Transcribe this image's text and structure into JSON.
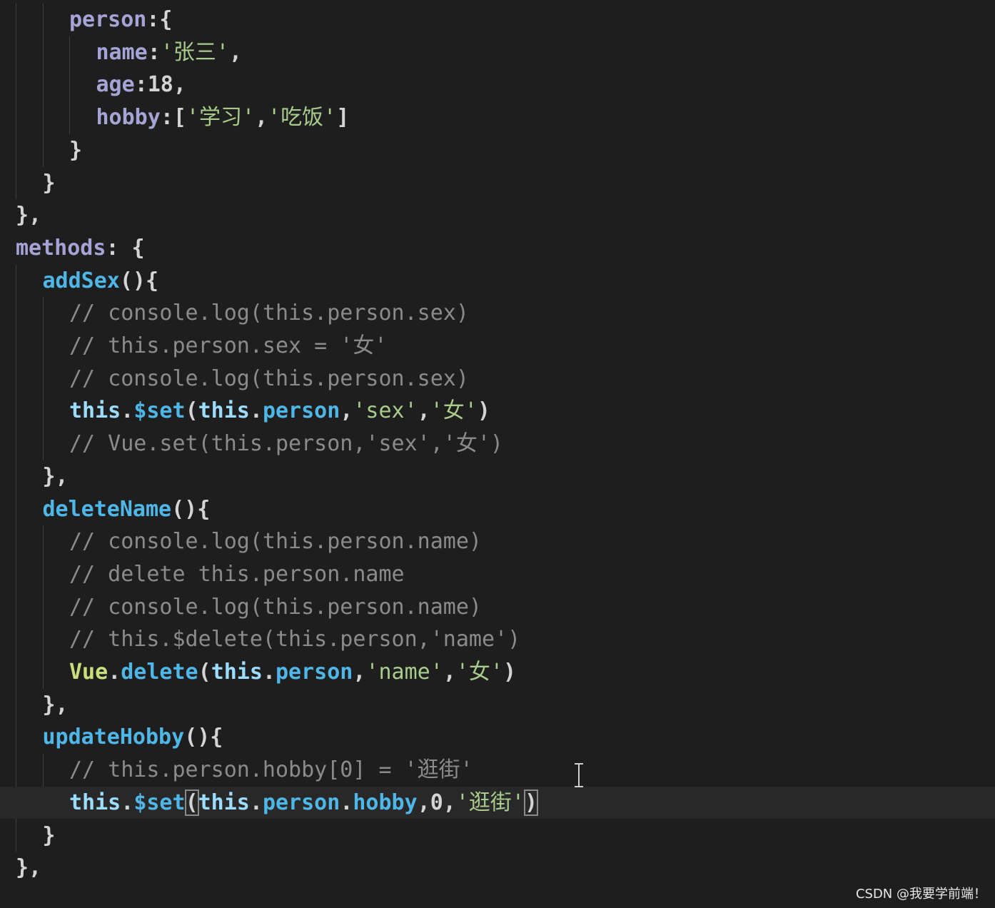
{
  "colors": {
    "background": "#1e1e1e",
    "current_line": "#282828",
    "property": "#a6a3d6",
    "string": "#a8cc8c",
    "number": "#d4d4d4",
    "punct": "#d4d4d4",
    "comment": "#8b8b8b",
    "this": "#9cdcfe",
    "function": "#4fb6e8",
    "member": "#4fb6e8",
    "vue": "#c8e07a"
  },
  "editor": {
    "current_line_index": 24,
    "lines": [
      {
        "indent": 2,
        "tokens": [
          {
            "t": "person",
            "k": "property"
          },
          {
            "t": ":{",
            "k": "punct"
          }
        ]
      },
      {
        "indent": 3,
        "tokens": [
          {
            "t": "name",
            "k": "property"
          },
          {
            "t": ":",
            "k": "punct"
          },
          {
            "t": "'张三'",
            "k": "string"
          },
          {
            "t": ",",
            "k": "punct"
          }
        ]
      },
      {
        "indent": 3,
        "tokens": [
          {
            "t": "age",
            "k": "property"
          },
          {
            "t": ":18,",
            "k": "punct"
          }
        ]
      },
      {
        "indent": 3,
        "tokens": [
          {
            "t": "hobby",
            "k": "property"
          },
          {
            "t": ":[",
            "k": "punct"
          },
          {
            "t": "'学习'",
            "k": "string"
          },
          {
            "t": ",",
            "k": "punct"
          },
          {
            "t": "'吃饭'",
            "k": "string"
          },
          {
            "t": "]",
            "k": "punct"
          }
        ]
      },
      {
        "indent": 2,
        "tokens": [
          {
            "t": "}",
            "k": "punct"
          }
        ]
      },
      {
        "indent": 1,
        "tokens": [
          {
            "t": "}",
            "k": "punct"
          }
        ]
      },
      {
        "indent": 0,
        "tokens": [
          {
            "t": "},",
            "k": "punct"
          }
        ]
      },
      {
        "indent": 0,
        "tokens": [
          {
            "t": "methods",
            "k": "property"
          },
          {
            "t": ": {",
            "k": "punct"
          }
        ]
      },
      {
        "indent": 1,
        "tokens": [
          {
            "t": "addSex",
            "k": "function"
          },
          {
            "t": "(){",
            "k": "punct"
          }
        ]
      },
      {
        "indent": 2,
        "tokens": [
          {
            "t": "// console.log(this.person.sex)",
            "k": "comment"
          }
        ]
      },
      {
        "indent": 2,
        "tokens": [
          {
            "t": "// this.person.sex = '女'",
            "k": "comment"
          }
        ]
      },
      {
        "indent": 2,
        "tokens": [
          {
            "t": "// console.log(this.person.sex)",
            "k": "comment"
          }
        ]
      },
      {
        "indent": 2,
        "tokens": [
          {
            "t": "this",
            "k": "this"
          },
          {
            "t": ".",
            "k": "punct"
          },
          {
            "t": "$set",
            "k": "member"
          },
          {
            "t": "(",
            "k": "punct"
          },
          {
            "t": "this",
            "k": "this"
          },
          {
            "t": ".",
            "k": "punct"
          },
          {
            "t": "person",
            "k": "member"
          },
          {
            "t": ",",
            "k": "punct"
          },
          {
            "t": "'sex'",
            "k": "string"
          },
          {
            "t": ",",
            "k": "punct"
          },
          {
            "t": "'女'",
            "k": "string"
          },
          {
            "t": ")",
            "k": "punct"
          }
        ]
      },
      {
        "indent": 2,
        "tokens": [
          {
            "t": "// Vue.set(this.person,'sex','女')",
            "k": "comment"
          }
        ]
      },
      {
        "indent": 1,
        "tokens": [
          {
            "t": "},",
            "k": "punct"
          }
        ]
      },
      {
        "indent": 1,
        "tokens": [
          {
            "t": "deleteName",
            "k": "function"
          },
          {
            "t": "(){",
            "k": "punct"
          }
        ]
      },
      {
        "indent": 2,
        "tokens": [
          {
            "t": "// console.log(this.person.name)",
            "k": "comment"
          }
        ]
      },
      {
        "indent": 2,
        "tokens": [
          {
            "t": "// delete this.person.name",
            "k": "comment"
          }
        ]
      },
      {
        "indent": 2,
        "tokens": [
          {
            "t": "// console.log(this.person.name)",
            "k": "comment"
          }
        ]
      },
      {
        "indent": 2,
        "tokens": [
          {
            "t": "// this.$delete(this.person,'name')",
            "k": "comment"
          }
        ]
      },
      {
        "indent": 2,
        "tokens": [
          {
            "t": "Vue",
            "k": "vue"
          },
          {
            "t": ".",
            "k": "punct"
          },
          {
            "t": "delete",
            "k": "member"
          },
          {
            "t": "(",
            "k": "punct"
          },
          {
            "t": "this",
            "k": "this"
          },
          {
            "t": ".",
            "k": "punct"
          },
          {
            "t": "person",
            "k": "member"
          },
          {
            "t": ",",
            "k": "punct"
          },
          {
            "t": "'name'",
            "k": "string"
          },
          {
            "t": ",",
            "k": "punct"
          },
          {
            "t": "'女'",
            "k": "string"
          },
          {
            "t": ")",
            "k": "punct"
          }
        ]
      },
      {
        "indent": 1,
        "tokens": [
          {
            "t": "},",
            "k": "punct"
          }
        ]
      },
      {
        "indent": 1,
        "tokens": [
          {
            "t": "updateHobby",
            "k": "function"
          },
          {
            "t": "(){",
            "k": "punct"
          }
        ]
      },
      {
        "indent": 2,
        "tokens": [
          {
            "t": "// this.person.hobby[0] = '逛街'",
            "k": "comment"
          }
        ]
      },
      {
        "indent": 2,
        "tokens": [
          {
            "t": "this",
            "k": "this"
          },
          {
            "t": ".",
            "k": "punct"
          },
          {
            "t": "$set",
            "k": "member"
          },
          {
            "t": "(",
            "k": "punct",
            "box": true
          },
          {
            "t": "this",
            "k": "this"
          },
          {
            "t": ".",
            "k": "punct"
          },
          {
            "t": "person",
            "k": "member"
          },
          {
            "t": ".",
            "k": "punct"
          },
          {
            "t": "hobby",
            "k": "member"
          },
          {
            "t": ",0,",
            "k": "punct"
          },
          {
            "t": "'逛街'",
            "k": "string"
          },
          {
            "t": ")",
            "k": "punct",
            "box": true
          }
        ]
      },
      {
        "indent": 1,
        "tokens": [
          {
            "t": "}",
            "k": "punct"
          }
        ]
      },
      {
        "indent": 0,
        "tokens": [
          {
            "t": "},",
            "k": "punct"
          }
        ]
      }
    ]
  },
  "watermark": "CSDN @我要学前端！"
}
